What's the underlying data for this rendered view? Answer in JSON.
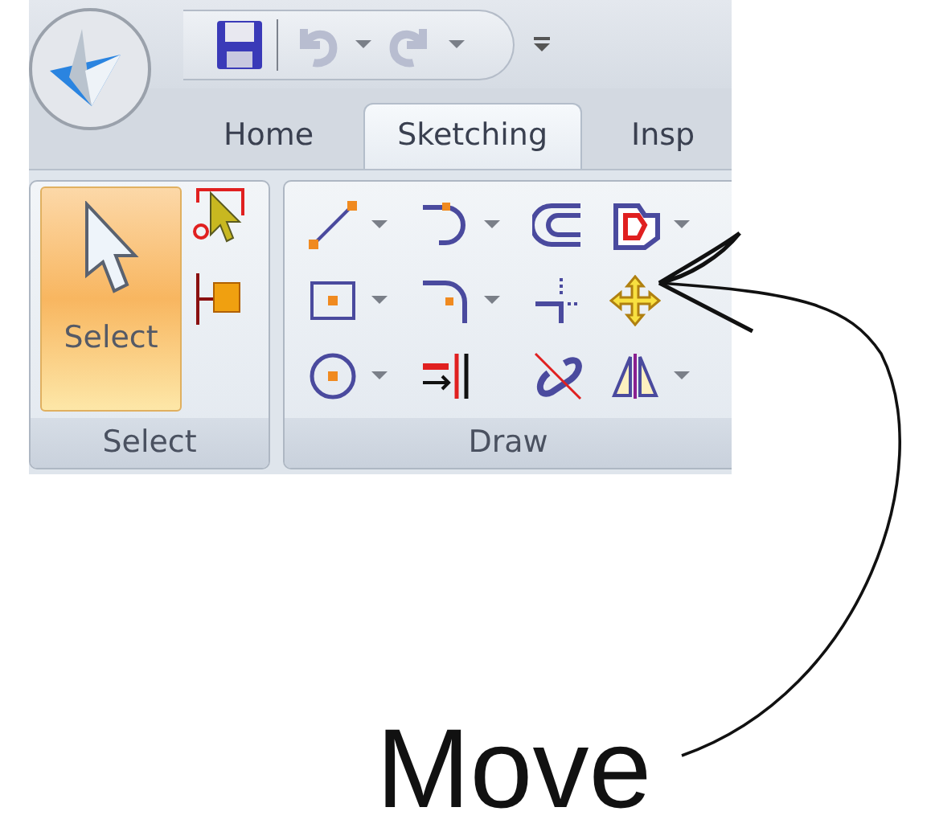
{
  "quick_access": [
    {
      "kind": "save",
      "disabled": false
    },
    {
      "kind": "undo",
      "disabled": true
    },
    {
      "kind": "redo",
      "disabled": true
    }
  ],
  "tabs": [
    {
      "label": "Home",
      "selected": false
    },
    {
      "label": "Sketching",
      "selected": true
    },
    {
      "label": "Insp",
      "selected": false
    }
  ],
  "groups": [
    {
      "label": "Select",
      "large_button": {
        "label": "Select",
        "selected": true
      }
    },
    {
      "label": "Draw"
    }
  ],
  "annotation": {
    "label": "Move"
  }
}
